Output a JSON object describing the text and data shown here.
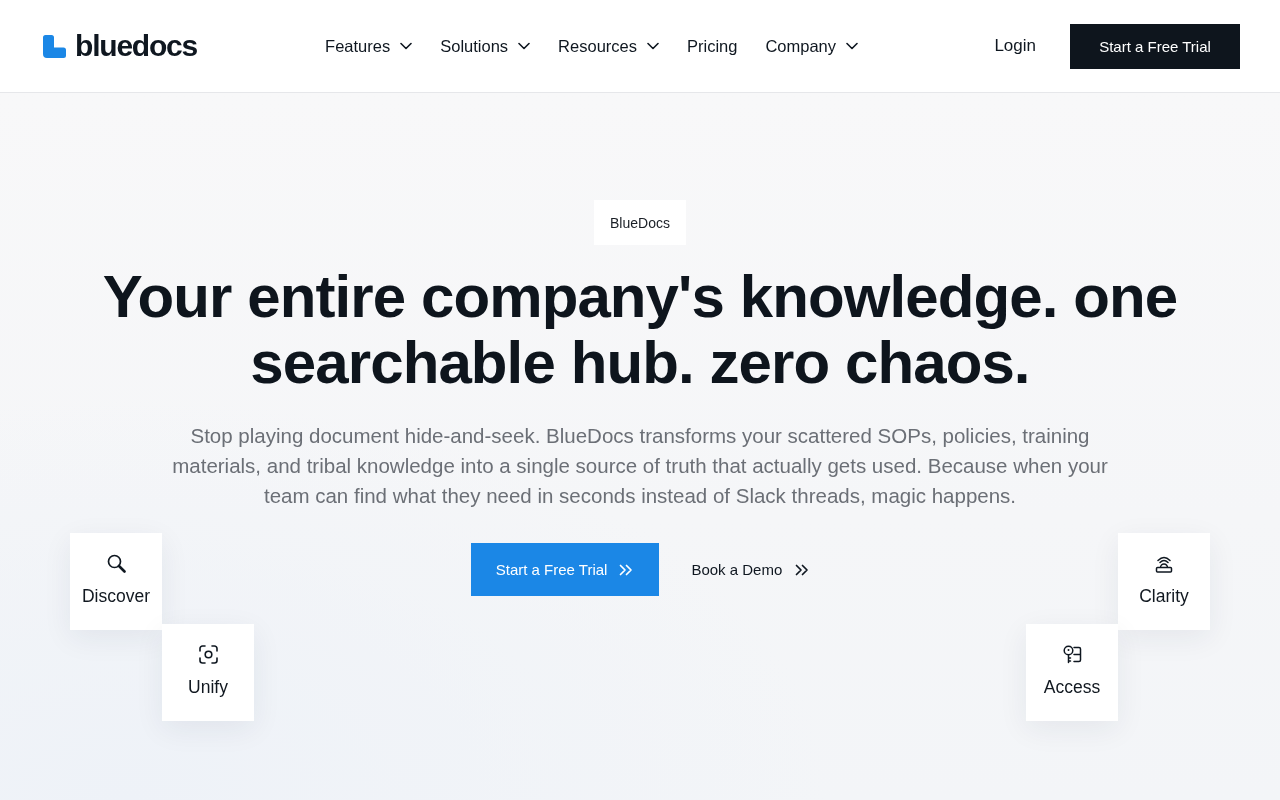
{
  "header": {
    "logo": {
      "text": "bluedocs"
    },
    "nav": [
      {
        "label": "Features",
        "has_menu": true
      },
      {
        "label": "Solutions",
        "has_menu": true
      },
      {
        "label": "Resources",
        "has_menu": true
      },
      {
        "label": "Pricing",
        "has_menu": false
      },
      {
        "label": "Company",
        "has_menu": true
      }
    ],
    "login": "Login",
    "cta": "Start a Free Trial"
  },
  "hero": {
    "badge": "BlueDocs",
    "headline": "Your entire company's knowledge. one searchable hub. zero chaos.",
    "description": "Stop playing document hide-and-seek. BlueDocs transforms your scattered SOPs, policies, training materials, and tribal knowledge into a single source of truth that actually gets used. Because when your team can find what they need in seconds instead of Slack threads, magic happens.",
    "primary_button": "Start a Free Trial",
    "secondary_button": "Book a Demo",
    "features": [
      {
        "label": "Discover",
        "kind": "search"
      },
      {
        "label": "Unify",
        "kind": "scan"
      },
      {
        "label": "Clarity",
        "kind": "bell"
      },
      {
        "label": "Access",
        "kind": "key"
      }
    ]
  }
}
